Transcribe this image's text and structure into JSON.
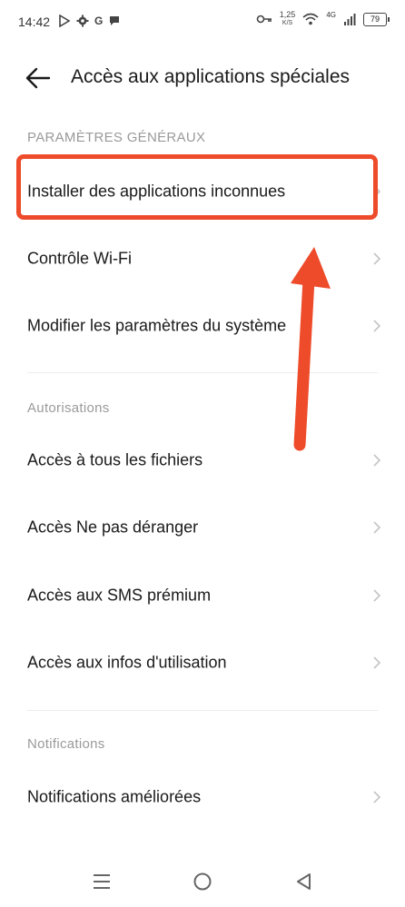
{
  "status_bar": {
    "time": "14:42",
    "left_icons": [
      "play-store-icon",
      "settings-gear-icon",
      "google-g-icon",
      "chat-bubble-icon"
    ],
    "google_letter": "G",
    "net_speed_value": "1,25",
    "net_speed_unit": "K/S",
    "network_type": "4G",
    "battery": "79"
  },
  "header": {
    "title": "Accès aux applications spéciales"
  },
  "sections": {
    "general": {
      "label": "PARAMÈTRES GÉNÉRAUX",
      "items": [
        {
          "label": "Installer des applications inconnues"
        },
        {
          "label": "Contrôle Wi-Fi"
        },
        {
          "label": "Modifier les paramètres du système"
        }
      ]
    },
    "permissions": {
      "label": "Autorisations",
      "items": [
        {
          "label": "Accès à tous les fichiers"
        },
        {
          "label": "Accès Ne pas déranger"
        },
        {
          "label": "Accès aux SMS prémium"
        },
        {
          "label": "Accès aux infos d'utilisation"
        }
      ]
    },
    "notifications": {
      "label": "Notifications",
      "items": [
        {
          "label": "Notifications améliorées"
        }
      ]
    }
  },
  "annotation": {
    "highlight_color": "#ee4b2b"
  },
  "navigation_bar": {
    "buttons": [
      "menu-icon",
      "home-circle-icon",
      "back-triangle-icon"
    ]
  },
  "colors": {
    "text": "#1a1a1a",
    "section_label": "#9a9a9a",
    "chevron": "#c4c4c4",
    "background": "#ffffff"
  }
}
